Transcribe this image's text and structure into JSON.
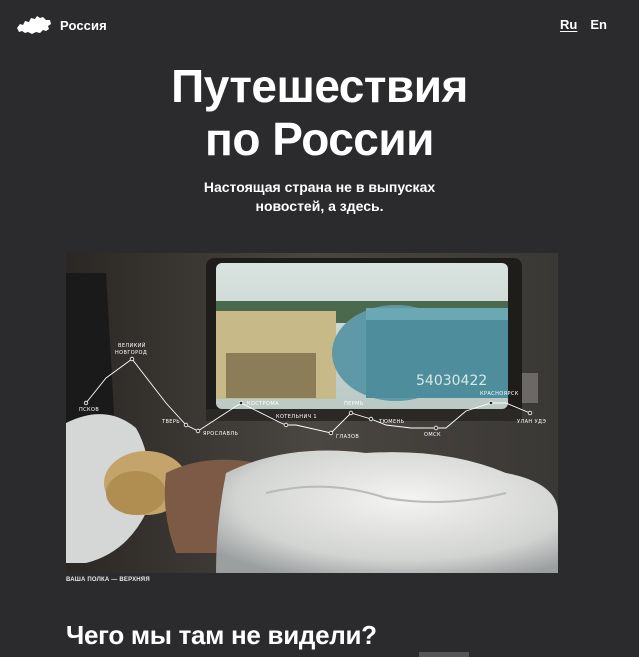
{
  "header": {
    "logo_text": "Россия",
    "lang": [
      {
        "label": "Ru",
        "active": true
      },
      {
        "label": "En",
        "active": false
      }
    ]
  },
  "hero": {
    "title": "Путешествия\nпо России",
    "subtitle": "Настоящая страна не в выпусках\nновостей, а здесь.",
    "caption": "ВАША ПОЛКА — ВЕРХНЯЯ",
    "window_text": "54030422"
  },
  "route_labels": {
    "pskov": "ПСКОВ",
    "novgorod_1": "ВЕЛИКИЙ",
    "novgorod_2": "НОВГОРОД",
    "tver": "ТВЕРЬ",
    "yaroslavl": "ЯРОСЛАВЛЬ",
    "kostroma": "КОСТРОМА",
    "kotelnich": "КОТЕЛЬНИЧ 1",
    "glazov": "ГЛАЗОВ",
    "perm": "ПЕРМЬ",
    "tyumen": "ТЮМЕНЬ",
    "omsk": "ОМСК",
    "krasnoyarsk": "КРАСНОЯРСК",
    "ulan_ude": "УЛАН УДЭ"
  },
  "section": {
    "title": "Чего мы там не видели?"
  }
}
